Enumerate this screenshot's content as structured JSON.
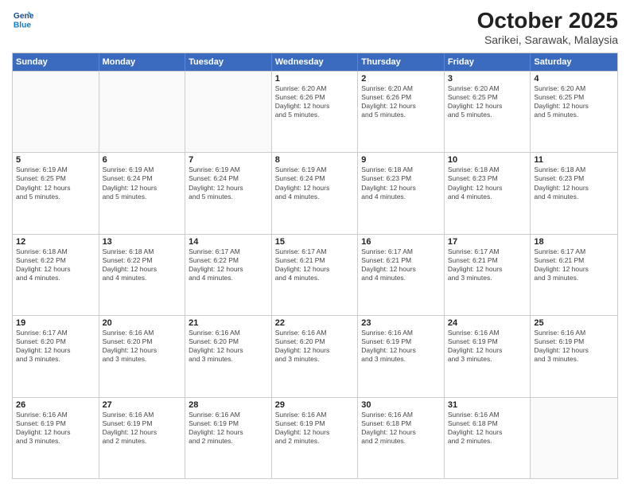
{
  "header": {
    "logo": {
      "line1": "General",
      "line2": "Blue"
    },
    "title": "October 2025",
    "subtitle": "Sarikei, Sarawak, Malaysia"
  },
  "days_of_week": [
    "Sunday",
    "Monday",
    "Tuesday",
    "Wednesday",
    "Thursday",
    "Friday",
    "Saturday"
  ],
  "weeks": [
    [
      {
        "day": "",
        "info": ""
      },
      {
        "day": "",
        "info": ""
      },
      {
        "day": "",
        "info": ""
      },
      {
        "day": "1",
        "info": "Sunrise: 6:20 AM\nSunset: 6:26 PM\nDaylight: 12 hours\nand 5 minutes."
      },
      {
        "day": "2",
        "info": "Sunrise: 6:20 AM\nSunset: 6:26 PM\nDaylight: 12 hours\nand 5 minutes."
      },
      {
        "day": "3",
        "info": "Sunrise: 6:20 AM\nSunset: 6:25 PM\nDaylight: 12 hours\nand 5 minutes."
      },
      {
        "day": "4",
        "info": "Sunrise: 6:20 AM\nSunset: 6:25 PM\nDaylight: 12 hours\nand 5 minutes."
      }
    ],
    [
      {
        "day": "5",
        "info": "Sunrise: 6:19 AM\nSunset: 6:25 PM\nDaylight: 12 hours\nand 5 minutes."
      },
      {
        "day": "6",
        "info": "Sunrise: 6:19 AM\nSunset: 6:24 PM\nDaylight: 12 hours\nand 5 minutes."
      },
      {
        "day": "7",
        "info": "Sunrise: 6:19 AM\nSunset: 6:24 PM\nDaylight: 12 hours\nand 5 minutes."
      },
      {
        "day": "8",
        "info": "Sunrise: 6:19 AM\nSunset: 6:24 PM\nDaylight: 12 hours\nand 4 minutes."
      },
      {
        "day": "9",
        "info": "Sunrise: 6:18 AM\nSunset: 6:23 PM\nDaylight: 12 hours\nand 4 minutes."
      },
      {
        "day": "10",
        "info": "Sunrise: 6:18 AM\nSunset: 6:23 PM\nDaylight: 12 hours\nand 4 minutes."
      },
      {
        "day": "11",
        "info": "Sunrise: 6:18 AM\nSunset: 6:23 PM\nDaylight: 12 hours\nand 4 minutes."
      }
    ],
    [
      {
        "day": "12",
        "info": "Sunrise: 6:18 AM\nSunset: 6:22 PM\nDaylight: 12 hours\nand 4 minutes."
      },
      {
        "day": "13",
        "info": "Sunrise: 6:18 AM\nSunset: 6:22 PM\nDaylight: 12 hours\nand 4 minutes."
      },
      {
        "day": "14",
        "info": "Sunrise: 6:17 AM\nSunset: 6:22 PM\nDaylight: 12 hours\nand 4 minutes."
      },
      {
        "day": "15",
        "info": "Sunrise: 6:17 AM\nSunset: 6:21 PM\nDaylight: 12 hours\nand 4 minutes."
      },
      {
        "day": "16",
        "info": "Sunrise: 6:17 AM\nSunset: 6:21 PM\nDaylight: 12 hours\nand 4 minutes."
      },
      {
        "day": "17",
        "info": "Sunrise: 6:17 AM\nSunset: 6:21 PM\nDaylight: 12 hours\nand 3 minutes."
      },
      {
        "day": "18",
        "info": "Sunrise: 6:17 AM\nSunset: 6:21 PM\nDaylight: 12 hours\nand 3 minutes."
      }
    ],
    [
      {
        "day": "19",
        "info": "Sunrise: 6:17 AM\nSunset: 6:20 PM\nDaylight: 12 hours\nand 3 minutes."
      },
      {
        "day": "20",
        "info": "Sunrise: 6:16 AM\nSunset: 6:20 PM\nDaylight: 12 hours\nand 3 minutes."
      },
      {
        "day": "21",
        "info": "Sunrise: 6:16 AM\nSunset: 6:20 PM\nDaylight: 12 hours\nand 3 minutes."
      },
      {
        "day": "22",
        "info": "Sunrise: 6:16 AM\nSunset: 6:20 PM\nDaylight: 12 hours\nand 3 minutes."
      },
      {
        "day": "23",
        "info": "Sunrise: 6:16 AM\nSunset: 6:19 PM\nDaylight: 12 hours\nand 3 minutes."
      },
      {
        "day": "24",
        "info": "Sunrise: 6:16 AM\nSunset: 6:19 PM\nDaylight: 12 hours\nand 3 minutes."
      },
      {
        "day": "25",
        "info": "Sunrise: 6:16 AM\nSunset: 6:19 PM\nDaylight: 12 hours\nand 3 minutes."
      }
    ],
    [
      {
        "day": "26",
        "info": "Sunrise: 6:16 AM\nSunset: 6:19 PM\nDaylight: 12 hours\nand 3 minutes."
      },
      {
        "day": "27",
        "info": "Sunrise: 6:16 AM\nSunset: 6:19 PM\nDaylight: 12 hours\nand 2 minutes."
      },
      {
        "day": "28",
        "info": "Sunrise: 6:16 AM\nSunset: 6:19 PM\nDaylight: 12 hours\nand 2 minutes."
      },
      {
        "day": "29",
        "info": "Sunrise: 6:16 AM\nSunset: 6:19 PM\nDaylight: 12 hours\nand 2 minutes."
      },
      {
        "day": "30",
        "info": "Sunrise: 6:16 AM\nSunset: 6:18 PM\nDaylight: 12 hours\nand 2 minutes."
      },
      {
        "day": "31",
        "info": "Sunrise: 6:16 AM\nSunset: 6:18 PM\nDaylight: 12 hours\nand 2 minutes."
      },
      {
        "day": "",
        "info": ""
      }
    ]
  ]
}
